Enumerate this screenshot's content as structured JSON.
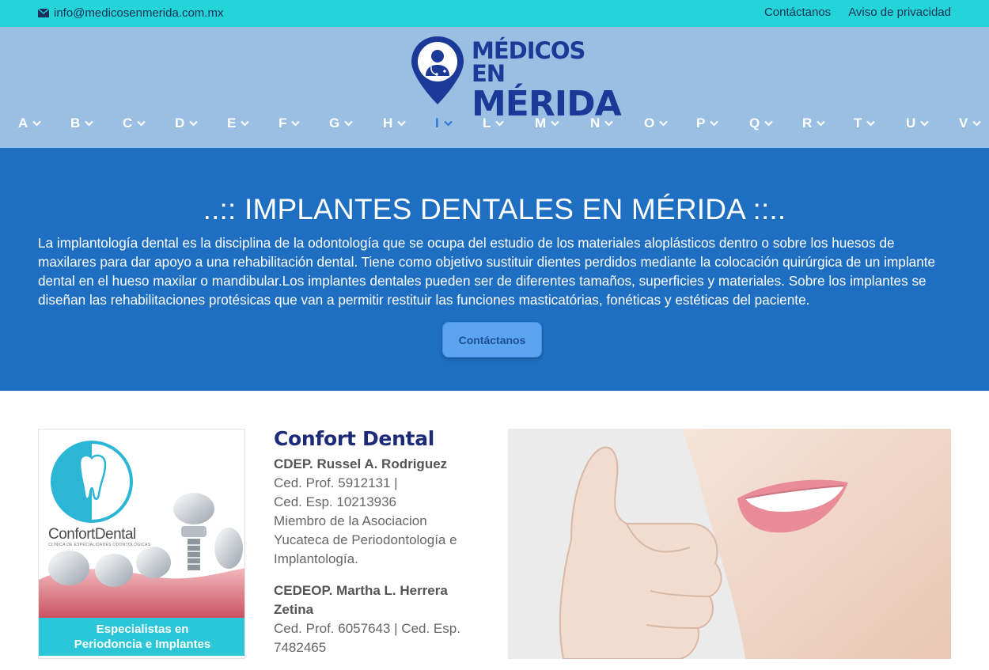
{
  "topbar": {
    "email": "info@medicosenmerida.com.mx",
    "links": [
      "Contáctanos",
      "Aviso de privacidad"
    ]
  },
  "logo": {
    "line1": "MÉDICOS EN",
    "line2": "MÉRIDA"
  },
  "alphabet": [
    {
      "label": "A"
    },
    {
      "label": "B"
    },
    {
      "label": "C"
    },
    {
      "label": "D"
    },
    {
      "label": "E"
    },
    {
      "label": "F"
    },
    {
      "label": "G"
    },
    {
      "label": "H"
    },
    {
      "label": "I",
      "active": true
    },
    {
      "label": "L"
    },
    {
      "label": "M"
    },
    {
      "label": "N"
    },
    {
      "label": "O"
    },
    {
      "label": "P"
    },
    {
      "label": "Q"
    },
    {
      "label": "R"
    },
    {
      "label": "T"
    },
    {
      "label": "U"
    },
    {
      "label": "V"
    }
  ],
  "hero": {
    "title": "..:: IMPLANTES DENTALES EN MÉRIDA ::..",
    "body": "La implantología dental es la disciplina de la odontología que se ocupa del estudio de los materiales aloplásticos dentro o sobre los huesos de maxilares para dar apoyo a una rehabilitación dental. Tiene como objetivo sustituir dientes perdidos mediante la colocación quirúrgica de un implante dental en el hueso maxilar o mandibular.Los implantes dentales pueden ser de diferentes tamaños, superficies y materiales. Sobre los implantes se diseñan las rehabilitaciones protésicas que van a permitir restituir las funciones masticatórias, fonéticas y estéticas del paciente.",
    "cta": "Contáctanos"
  },
  "ad": {
    "brand_a": "Confort",
    "brand_b": "Dental",
    "brand_sub": "CLÍNICA DE ESPECIALIDADES ODONTOLÓGICAS",
    "banner_line1": "Especialistas en",
    "banner_line2": "Periodoncia e Implantes"
  },
  "listing": {
    "title": "Confort Dental",
    "doctor1": {
      "name": "CDEP. Russel A. Rodriguez",
      "lines": [
        "Ced. Prof. 5912131 |",
        "Ced. Esp. 10213936",
        "Miembro de la Asociacion Yucateca de Periodontología e Implantología."
      ]
    },
    "doctor2": {
      "name": "CEDEOP. Martha L. Herrera Zetina",
      "lines": [
        "Ced. Prof. 6057643 | Ced. Esp. 7482465"
      ]
    }
  },
  "colors": {
    "topbar": "#23d5d8",
    "header": "#9bbfe3",
    "hero": "#1e6fc1",
    "active_letter": "#2a7ad5",
    "title_navy": "#1c2a78"
  }
}
